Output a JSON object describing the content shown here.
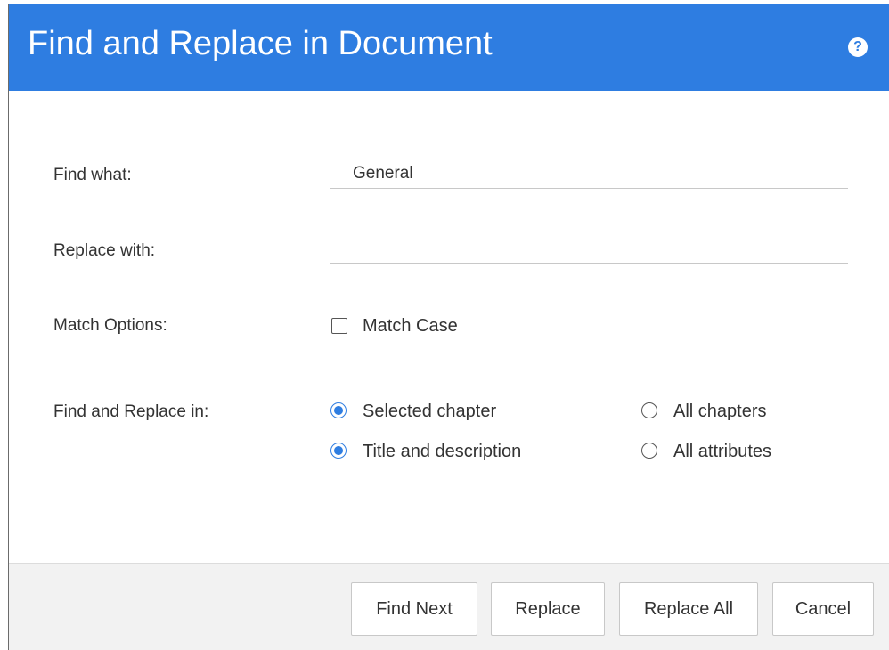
{
  "dialog": {
    "title": "Find and Replace in Document",
    "help_icon": "help-icon"
  },
  "form": {
    "find_what_label": "Find what:",
    "find_what_value": "General",
    "replace_with_label": "Replace with:",
    "replace_with_value": "",
    "match_options_label": "Match Options:",
    "match_case_label": "Match Case",
    "match_case_checked": false,
    "scope_label": "Find and Replace in:",
    "scope_options": {
      "selected_chapter": "Selected chapter",
      "all_chapters": "All chapters",
      "selected_value": "Selected chapter"
    },
    "field_options": {
      "title_and_description": "Title and description",
      "all_attributes": "All attributes",
      "selected_value": "Title and description"
    }
  },
  "footer": {
    "find_next_label": "Find Next",
    "replace_label": "Replace",
    "replace_all_label": "Replace All",
    "cancel_label": "Cancel"
  },
  "colors": {
    "header": "#2e7de1",
    "accent": "#2e7de1",
    "footer_bg": "#f2f2f2"
  }
}
